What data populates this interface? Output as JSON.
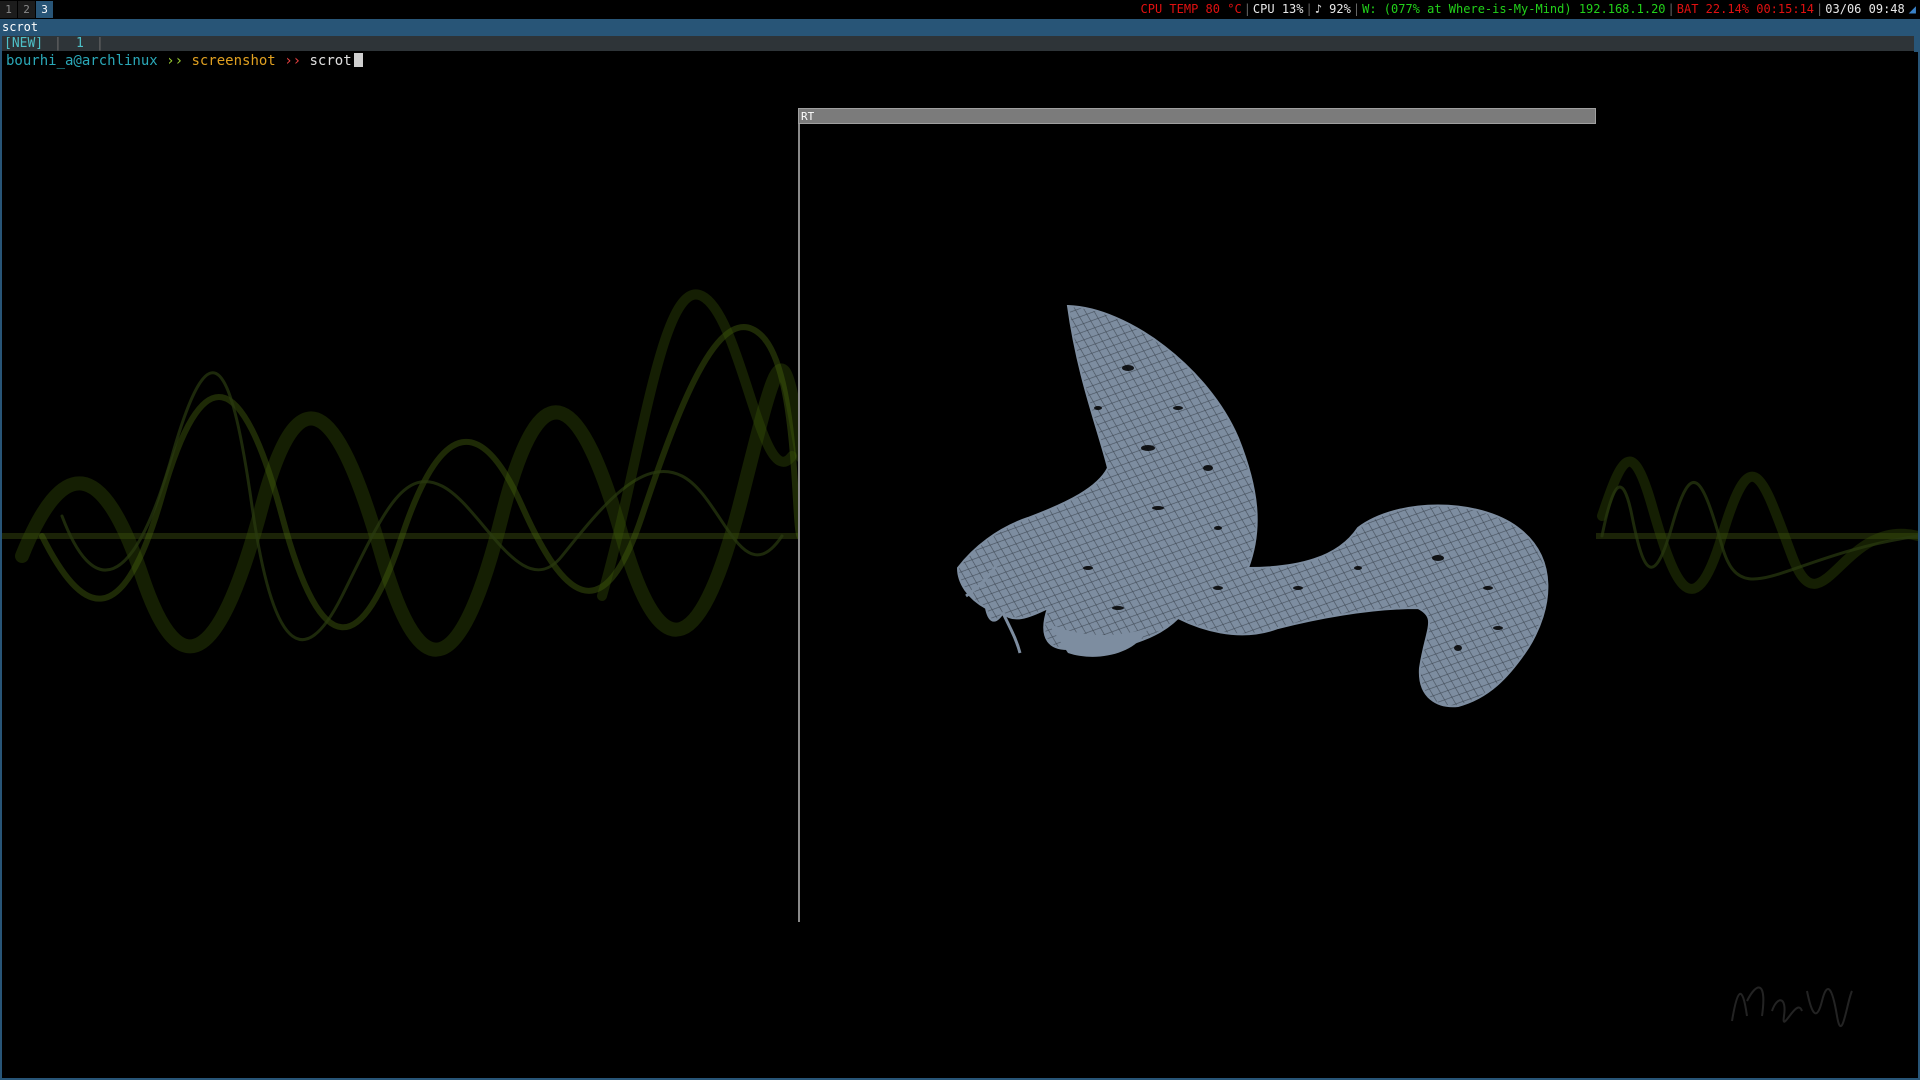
{
  "workspaces": [
    {
      "label": "1",
      "active": false
    },
    {
      "label": "2",
      "active": false
    },
    {
      "label": "3",
      "active": true
    }
  ],
  "status": {
    "cpu_temp": "CPU TEMP 80 °C",
    "cpu_usage": "CPU 13%",
    "volume": "♪ 92%",
    "wifi": "W: (077% at Where-is-My-Mind) 192.168.1.20",
    "battery": "BAT 22.14% 00:15:14",
    "datetime": "03/06 09:48"
  },
  "window": {
    "title": "scrot"
  },
  "tmux": {
    "new_label": "[NEW]",
    "window_label": "1"
  },
  "prompt": {
    "user": "bourhi_a@archlinux",
    "arrow1": "››",
    "dir": "screenshot",
    "arrow2": "››",
    "command": "scrot"
  },
  "rt_window": {
    "title": "RT",
    "model_color": "#7d8da0"
  },
  "colors": {
    "accent": "#285577",
    "temp_warning": "#e01010",
    "network_ok": "#22d01a"
  }
}
